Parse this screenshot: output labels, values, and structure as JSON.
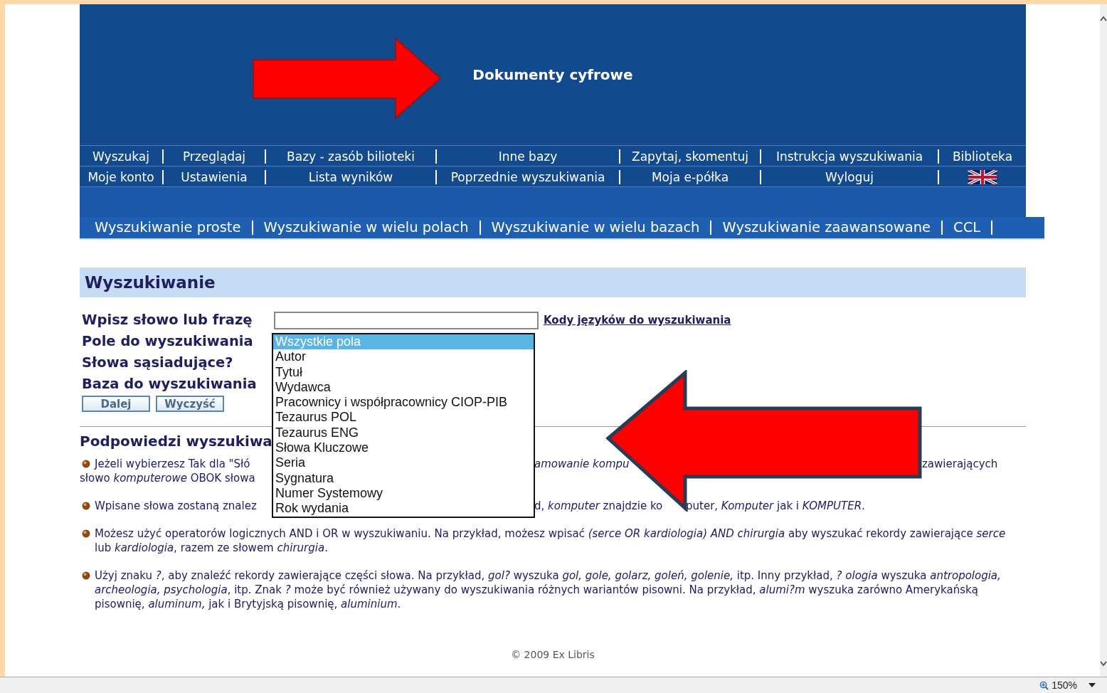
{
  "header": {
    "title": "Dokumenty cyfrowe"
  },
  "nav_rows": [
    [
      "Wyszukaj",
      "Przeglądaj",
      "Bazy - zasób bilioteki",
      "Inne bazy",
      "Zapytaj, skomentuj",
      "Instrukcja wyszukiwania",
      "Biblioteka"
    ],
    [
      "Moje konto",
      "Ustawienia",
      "Lista wyników",
      "Poprzednie wyszukiwania",
      "Moja e-półka",
      "Wyloguj"
    ]
  ],
  "search_tabs": [
    "Wyszukiwanie proste",
    "Wyszukiwanie w wielu polach",
    "Wyszukiwanie w wielu bazach",
    "Wyszukiwanie zaawansowane",
    "CCL"
  ],
  "section_title": "Wyszukiwanie",
  "form": {
    "labels": [
      "Wpisz słowo lub frazę",
      "Pole do wyszukiwania",
      "Słowa sąsiadujące?",
      "Baza do wyszukiwania"
    ],
    "link": "Kody języków do wyszukiwania",
    "buttons": [
      "Dalej",
      "Wyczyść"
    ],
    "dropdown": [
      {
        "label": "Wszystkie pola",
        "selected": true
      },
      {
        "label": "Autor",
        "selected": false
      },
      {
        "label": "Tytuł",
        "selected": false
      },
      {
        "label": "Wydawca",
        "selected": false
      },
      {
        "label": "Pracownicy i współpracownicy CIOP-PIB",
        "selected": false
      },
      {
        "label": "Tezaurus POL",
        "selected": false
      },
      {
        "label": "Tezaurus ENG",
        "selected": false
      },
      {
        "label": "Słowa Kluczowe",
        "selected": false
      },
      {
        "label": "Seria",
        "selected": false
      },
      {
        "label": "Sygnatura",
        "selected": false
      },
      {
        "label": "Numer Systemowy",
        "selected": false
      },
      {
        "label": "Rok wydania",
        "selected": false
      }
    ]
  },
  "hints_title": "Podpowiedzi wyszukiwa",
  "hints": [
    {
      "lines": [
        [
          "Jeżeli wybierzesz Tak dla \"Słó",
          "*amowanie kompu*",
          "zawierających"
        ],
        [
          "słowo *komputerowe* OBOK słowa"
        ]
      ]
    },
    {
      "lines": [
        [
          "Wpisane słowa zostaną znalez",
          "d, *komputer* znajdzie ko",
          "puter, *Komputer* jak i *KOMPUTER*."
        ]
      ]
    },
    {
      "text": "Możesz użyć operatorów logicznych AND i OR w wyszukiwaniu. Na przykład, możesz wpisać *(serce OR kardiologia) AND chirurgia* aby wyszukać rekordy zawierające *serce* lub *kardiologia*, razem ze słowem *chirurgia*."
    },
    {
      "text": "Użyj znaku *?*, aby znaleźć rekordy zawierające części słowa. Na przykład, *gol?* wyszuka *gol, gole, golarz, goleń, golenie,* itp. Inny przykład, *? ologia* wyszuka *antropologia, archeologia, psychologia*, itp. Znak *?* może być również używany do wyszukiwania różnych wariantów pisowni. Na przykład, *alumi?m* wyszuka zarówno Amerykańską pisownię, *aluminum,* jak i Brytyjską pisownię, *aluminium*."
    }
  ],
  "footer": "© 2009 Ex Libris",
  "status_bar": {
    "zoom": "150%"
  }
}
